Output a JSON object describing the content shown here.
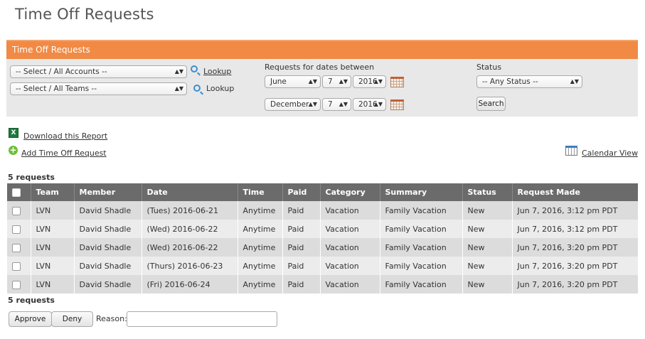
{
  "page_title": "Time Off Requests",
  "panel": {
    "title": "Time Off Requests",
    "accounts_select": "-- Select / All Accounts --",
    "teams_select": "-- Select / All Teams --",
    "lookup_accounts": "Lookup",
    "lookup_teams": "Lookup",
    "dates_label": "Requests for dates between",
    "start": {
      "month": "June",
      "day": "7",
      "year": "2016"
    },
    "end": {
      "month": "December",
      "day": "7",
      "year": "2016"
    },
    "status_label": "Status",
    "status_select": "-- Any Status --",
    "search_button": "Search"
  },
  "links": {
    "download": "Download this Report",
    "add_request": "Add Time Off Request",
    "calendar_view": "Calendar View"
  },
  "count_text": "5 requests",
  "table": {
    "headers": [
      "Team",
      "Member",
      "Date",
      "Time",
      "Paid",
      "Category",
      "Summary",
      "Status",
      "Request Made"
    ],
    "rows": [
      [
        "LVN",
        "David Shadle",
        "(Tues) 2016-06-21",
        "Anytime",
        "Paid",
        "Vacation",
        "Family Vacation",
        "New",
        "Jun 7, 2016, 3:12 pm PDT"
      ],
      [
        "LVN",
        "David Shadle",
        "(Wed) 2016-06-22",
        "Anytime",
        "Paid",
        "Vacation",
        "Family Vacation",
        "New",
        "Jun 7, 2016, 3:12 pm PDT"
      ],
      [
        "LVN",
        "David Shadle",
        "(Wed) 2016-06-22",
        "Anytime",
        "Paid",
        "Vacation",
        "Family Vacation",
        "New",
        "Jun 7, 2016, 3:20 pm PDT"
      ],
      [
        "LVN",
        "David Shadle",
        "(Thurs) 2016-06-23",
        "Anytime",
        "Paid",
        "Vacation",
        "Family Vacation",
        "New",
        "Jun 7, 2016, 3:20 pm PDT"
      ],
      [
        "LVN",
        "David Shadle",
        "(Fri) 2016-06-24",
        "Anytime",
        "Paid",
        "Vacation",
        "Family Vacation",
        "New",
        "Jun 7, 2016, 3:20 pm PDT"
      ]
    ]
  },
  "footer": {
    "approve": "Approve",
    "deny": "Deny",
    "reason_label": "Reason:",
    "reason_value": ""
  },
  "colors": {
    "accent": "#f08a45",
    "table_header": "#6b6b6b"
  }
}
